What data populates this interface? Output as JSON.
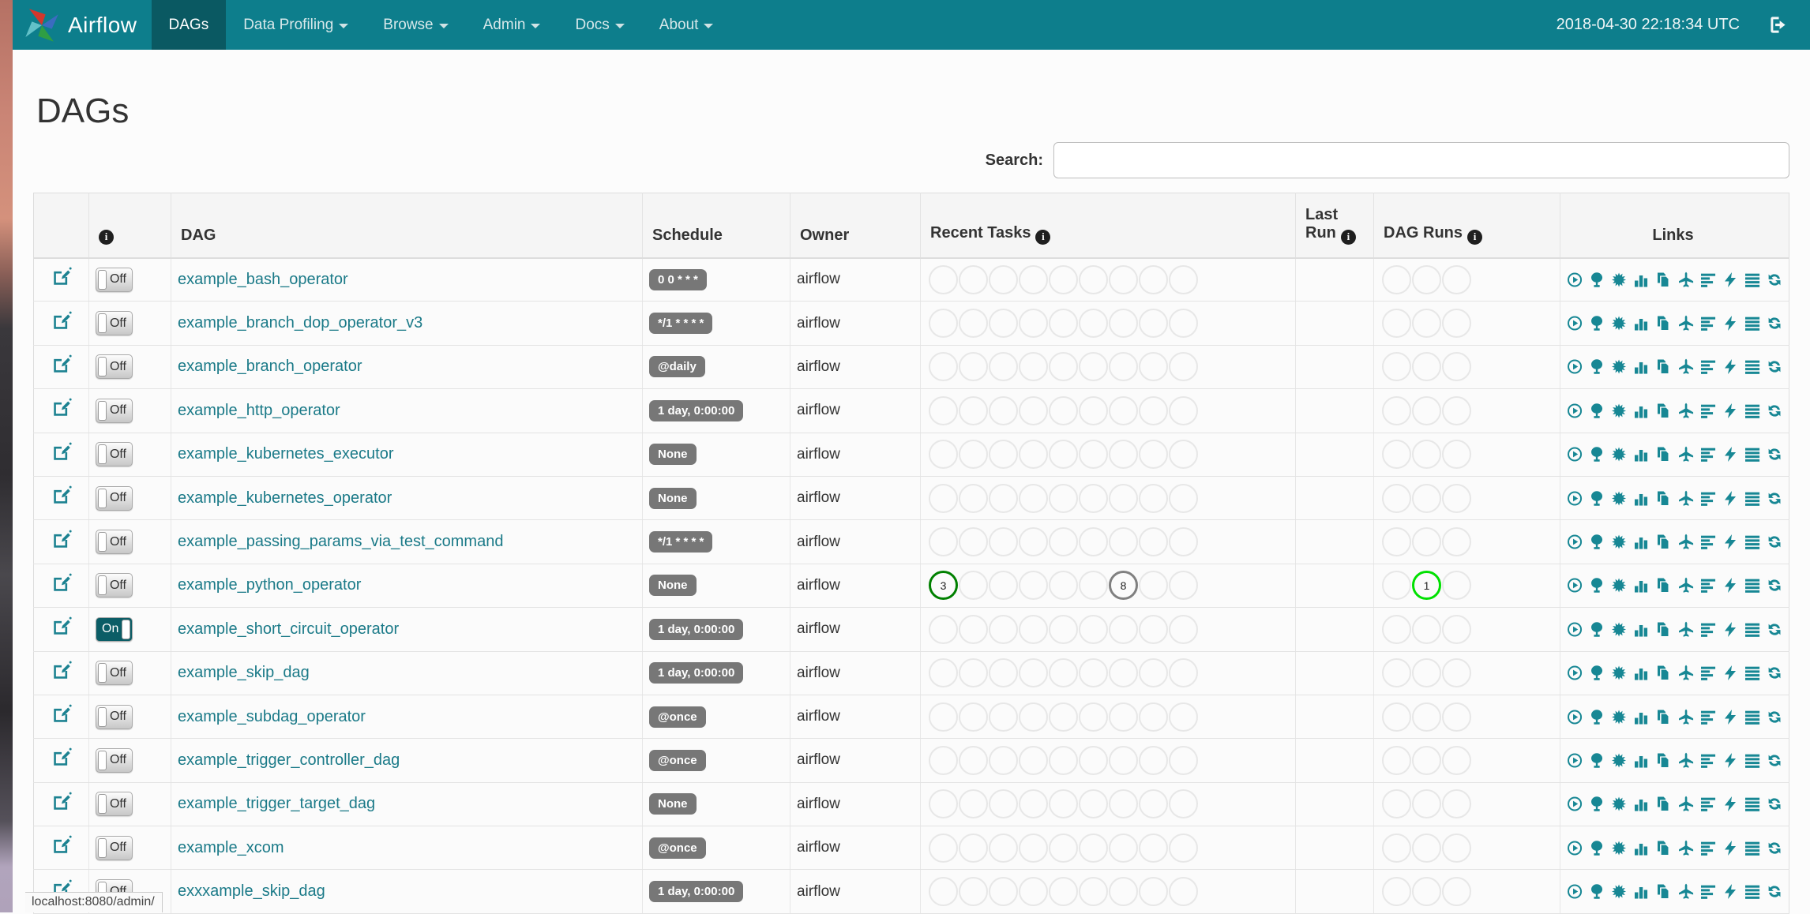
{
  "navbar": {
    "brand": "Airflow",
    "items": [
      {
        "id": "dags",
        "label": "DAGs",
        "active": true,
        "dropdown": false
      },
      {
        "id": "data-profiling",
        "label": "Data Profiling",
        "active": false,
        "dropdown": true
      },
      {
        "id": "browse",
        "label": "Browse",
        "active": false,
        "dropdown": true
      },
      {
        "id": "admin",
        "label": "Admin",
        "active": false,
        "dropdown": true
      },
      {
        "id": "docs",
        "label": "Docs",
        "active": false,
        "dropdown": true
      },
      {
        "id": "about",
        "label": "About",
        "active": false,
        "dropdown": true
      }
    ],
    "clock": "2018-04-30 22:18:34 UTC"
  },
  "page": {
    "title": "DAGs"
  },
  "search": {
    "label": "Search:",
    "value": "",
    "placeholder": ""
  },
  "colors": {
    "navbar": "#0d7e8c",
    "navbar_active": "#0a5962",
    "link_teal": "#1b7a88",
    "icon_teal": "#178794",
    "badge_gray": "#777777",
    "state_success": "#008000",
    "state_running": "#00e000",
    "state_queued": "#808080"
  },
  "table": {
    "headers": {
      "dag": "DAG",
      "schedule": "Schedule",
      "owner": "Owner",
      "recent_tasks": "Recent Tasks",
      "last_run": "Last Run",
      "dag_runs": "DAG Runs",
      "links": "Links"
    },
    "recent_tasks_slots": 9,
    "dag_runs_slots": 3,
    "link_icons": [
      {
        "name": "trigger-dag-icon",
        "symbol": "i-trigger"
      },
      {
        "name": "tree-view-icon",
        "symbol": "i-tree"
      },
      {
        "name": "graph-view-icon",
        "symbol": "i-graph"
      },
      {
        "name": "task-duration-icon",
        "symbol": "i-duration"
      },
      {
        "name": "task-tries-icon",
        "symbol": "i-tries"
      },
      {
        "name": "landing-times-icon",
        "symbol": "i-landing"
      },
      {
        "name": "gantt-icon",
        "symbol": "i-gantt"
      },
      {
        "name": "code-view-icon",
        "symbol": "i-code"
      },
      {
        "name": "logs-icon",
        "symbol": "i-logs"
      },
      {
        "name": "refresh-icon",
        "symbol": "i-refresh"
      }
    ],
    "rows": [
      {
        "dag_id": "example_bash_operator",
        "toggle": "Off",
        "schedule": "0 0 * * *",
        "owner": "airflow",
        "last_run": "",
        "recent_tasks": [],
        "dag_runs": []
      },
      {
        "dag_id": "example_branch_dop_operator_v3",
        "toggle": "Off",
        "schedule": "*/1 * * * *",
        "owner": "airflow",
        "last_run": "",
        "recent_tasks": [],
        "dag_runs": []
      },
      {
        "dag_id": "example_branch_operator",
        "toggle": "Off",
        "schedule": "@daily",
        "owner": "airflow",
        "last_run": "",
        "recent_tasks": [],
        "dag_runs": []
      },
      {
        "dag_id": "example_http_operator",
        "toggle": "Off",
        "schedule": "1 day, 0:00:00",
        "owner": "airflow",
        "last_run": "",
        "recent_tasks": [],
        "dag_runs": []
      },
      {
        "dag_id": "example_kubernetes_executor",
        "toggle": "Off",
        "schedule": "None",
        "owner": "airflow",
        "last_run": "",
        "recent_tasks": [],
        "dag_runs": []
      },
      {
        "dag_id": "example_kubernetes_operator",
        "toggle": "Off",
        "schedule": "None",
        "owner": "airflow",
        "last_run": "",
        "recent_tasks": [],
        "dag_runs": []
      },
      {
        "dag_id": "example_passing_params_via_test_command",
        "toggle": "Off",
        "schedule": "*/1 * * * *",
        "owner": "airflow",
        "last_run": "",
        "recent_tasks": [],
        "dag_runs": []
      },
      {
        "dag_id": "example_python_operator",
        "toggle": "Off",
        "schedule": "None",
        "owner": "airflow",
        "last_run": "",
        "recent_tasks": [
          {
            "slot": 1,
            "count": 3,
            "state": "success",
            "color": "#008000"
          },
          {
            "slot": 7,
            "count": 8,
            "state": "queued",
            "color": "#808080"
          }
        ],
        "dag_runs": [
          {
            "slot": 2,
            "count": 1,
            "state": "running",
            "color": "#00e000"
          }
        ]
      },
      {
        "dag_id": "example_short_circuit_operator",
        "toggle": "On",
        "schedule": "1 day, 0:00:00",
        "owner": "airflow",
        "last_run": "",
        "recent_tasks": [],
        "dag_runs": []
      },
      {
        "dag_id": "example_skip_dag",
        "toggle": "Off",
        "schedule": "1 day, 0:00:00",
        "owner": "airflow",
        "last_run": "",
        "recent_tasks": [],
        "dag_runs": []
      },
      {
        "dag_id": "example_subdag_operator",
        "toggle": "Off",
        "schedule": "@once",
        "owner": "airflow",
        "last_run": "",
        "recent_tasks": [],
        "dag_runs": []
      },
      {
        "dag_id": "example_trigger_controller_dag",
        "toggle": "Off",
        "schedule": "@once",
        "owner": "airflow",
        "last_run": "",
        "recent_tasks": [],
        "dag_runs": []
      },
      {
        "dag_id": "example_trigger_target_dag",
        "toggle": "Off",
        "schedule": "None",
        "owner": "airflow",
        "last_run": "",
        "recent_tasks": [],
        "dag_runs": []
      },
      {
        "dag_id": "example_xcom",
        "toggle": "Off",
        "schedule": "@once",
        "owner": "airflow",
        "last_run": "",
        "recent_tasks": [],
        "dag_runs": []
      },
      {
        "dag_id": "exxxample_skip_dag",
        "toggle": "Off",
        "schedule": "1 day, 0:00:00",
        "owner": "airflow",
        "last_run": "",
        "recent_tasks": [],
        "dag_runs": []
      }
    ]
  },
  "status_bar": {
    "url": "localhost:8080/admin/"
  }
}
